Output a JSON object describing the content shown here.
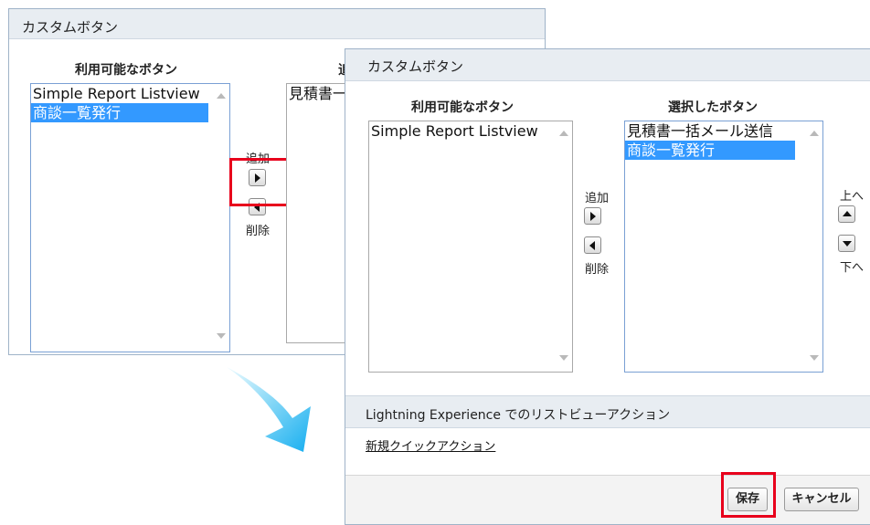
{
  "back_panel": {
    "title": "カスタムボタン",
    "available_title": "利用可能なボタン",
    "selected_title_partial": "追",
    "available_items": [
      {
        "label": "Simple Report Listview",
        "selected": false
      },
      {
        "label": "商談一覧発行",
        "selected": true
      }
    ],
    "selected_items": [
      {
        "label": "見積書一",
        "selected": false
      }
    ],
    "add_label": "追加",
    "remove_label": "削除"
  },
  "front_panel": {
    "title": "カスタムボタン",
    "available_title": "利用可能なボタン",
    "selected_title": "選択したボタン",
    "available_items": [
      {
        "label": "Simple Report Listview",
        "selected": false
      }
    ],
    "selected_items": [
      {
        "label": "見積書一括メール送信",
        "selected": false
      },
      {
        "label": "商談一覧発行",
        "selected": true
      }
    ],
    "add_label": "追加",
    "remove_label": "削除",
    "up_label": "上へ",
    "down_label": "下へ",
    "lightning_section_title": "Lightning Experience でのリストビューアクション",
    "quick_action_link": "新規クイックアクション",
    "save_label": "保存",
    "cancel_label": "キャンセル"
  },
  "colors": {
    "highlight": "#e8001c",
    "selection": "#3399ff",
    "header_bg": "#e8edf2",
    "arrow_gradient_start": "#dff6ff",
    "arrow_gradient_end": "#19b3ee"
  }
}
